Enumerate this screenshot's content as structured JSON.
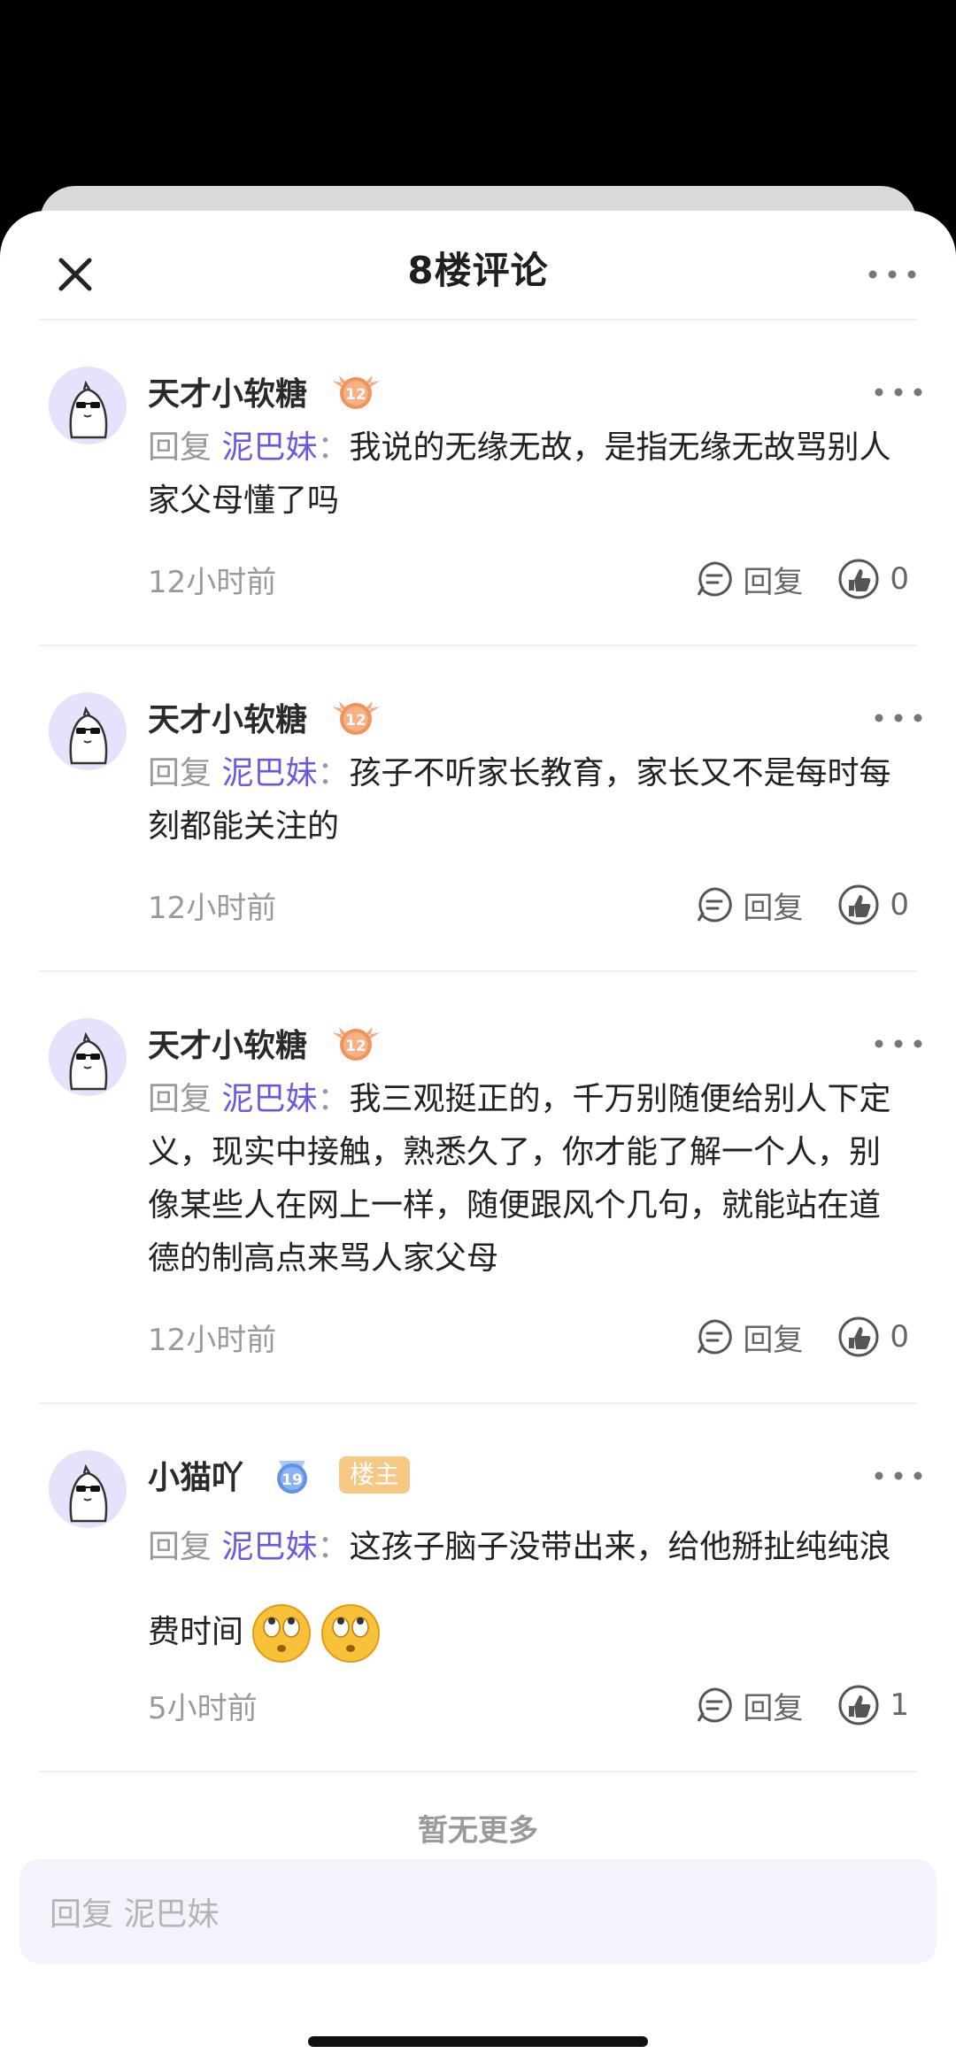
{
  "header": {
    "title": "8楼评论"
  },
  "comments": [
    {
      "username": "天才小软糖",
      "level": "12",
      "is_owner": false,
      "reply_prefix": "回复 ",
      "reply_target": "泥巴妹",
      "colon": "：",
      "text": "我说的无缘无故，是指无缘无故骂别人家父母懂了吗",
      "time": "12小时前",
      "reply_label": "回复",
      "likes": "0"
    },
    {
      "username": "天才小软糖",
      "level": "12",
      "is_owner": false,
      "reply_prefix": "回复 ",
      "reply_target": "泥巴妹",
      "colon": "：",
      "text": "孩子不听家长教育，家长又不是每时每刻都能关注的",
      "time": "12小时前",
      "reply_label": "回复",
      "likes": "0"
    },
    {
      "username": "天才小软糖",
      "level": "12",
      "is_owner": false,
      "reply_prefix": "回复 ",
      "reply_target": "泥巴妹",
      "colon": "：",
      "text": "我三观挺正的，千万别随便给别人下定义，现实中接触，熟悉久了，你才能了解一个人，别像某些人在网上一样，随便跟风个几句，就能站在道德的制高点来骂人家父母",
      "time": "12小时前",
      "reply_label": "回复",
      "likes": "0"
    },
    {
      "username": "小猫吖",
      "level": "19",
      "is_owner": true,
      "owner_label": "楼主",
      "reply_prefix": "回复 ",
      "reply_target": "泥巴妹",
      "colon": "：",
      "text": "这孩子脑子没带出来，给他掰扯纯纯浪费时间",
      "emojis": [
        "rolling-eyes-emoji",
        "rolling-eyes-emoji"
      ],
      "time": "5小时前",
      "reply_label": "回复",
      "likes": "1"
    }
  ],
  "footer": {
    "no_more": "暂无更多"
  },
  "input": {
    "placeholder": "回复 泥巴妹"
  },
  "colors": {
    "accent": "#6b58e0",
    "badge": "#f6c884",
    "input_bg": "#f3f3fd"
  }
}
